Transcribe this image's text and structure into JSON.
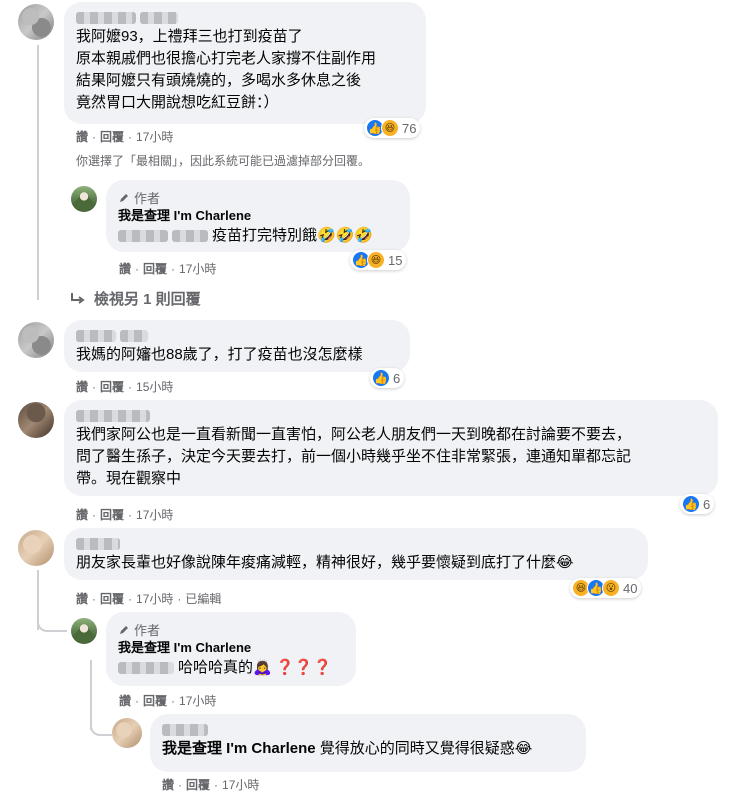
{
  "comments": [
    {
      "text_lines": [
        "我阿嬤93，上禮拜三也打到疫苗了",
        "原本親戚們也很擔心打完老人家撐不住副作用",
        "結果阿嬤只有頭燒燒的，多喝水多休息之後",
        "竟然胃口大開說想吃紅豆餅：）"
      ],
      "like": "讚",
      "reply": "回覆",
      "time": "17小時",
      "reaction_count": "76"
    },
    {
      "text": "我媽的阿嬸也88歲了，打了疫苗也沒怎麼樣",
      "like": "讚",
      "reply": "回覆",
      "time": "15小時",
      "reaction_count": "6"
    },
    {
      "text_lines": [
        "我們家阿公也是一直看新聞一直害怕，阿公老人朋友們一天到晚都在討論要不要去，",
        "問了醫生孫子，決定今天要去打，前一個小時幾乎坐不住非常緊張，連通知單都忘記",
        "帶。現在觀察中"
      ],
      "like": "讚",
      "reply": "回覆",
      "time": "17小時",
      "reaction_count": "6"
    },
    {
      "text": "朋友家長輩也好像說陳年痠痛減輕，精神很好，幾乎要懷疑到底打了什麼😂",
      "like": "讚",
      "reply": "回覆",
      "time": "17小時",
      "edited": "已編輯",
      "reaction_count": "40"
    }
  ],
  "filter_note": "你選擇了「最相關」，因此系統可能已過濾掉部分回覆。",
  "author_reply_1": {
    "badge": "作者",
    "name": "我是查理 I'm Charlene",
    "text": "疫苗打完特別餓🤣🤣🤣",
    "like": "讚",
    "reply": "回覆",
    "time": "17小時",
    "reaction_count": "15"
  },
  "view_more": "檢視另 1 則回覆",
  "author_reply_2": {
    "badge": "作者",
    "name": "我是查理 I'm Charlene",
    "text": "哈哈哈真的🙇‍♀️",
    "questions": "❓❓❓",
    "like": "讚",
    "reply": "回覆",
    "time": "17小時"
  },
  "nested_reply": {
    "mention": "我是查理 I'm Charlene",
    "text": "覺得放心的同時又覺得很疑惑😂",
    "like": "讚",
    "reply": "回覆",
    "time": "17小時"
  },
  "separator": "·",
  "icons": {
    "like": "like-icon",
    "haha": "haha-icon",
    "wow": "wow-icon",
    "pen": "pen-icon",
    "reply_arrow": "reply-arrow-icon"
  },
  "colors": {
    "like_blue": "#1877f2",
    "bubble_bg": "#f0f2f5",
    "meta_gray": "#65676b"
  }
}
